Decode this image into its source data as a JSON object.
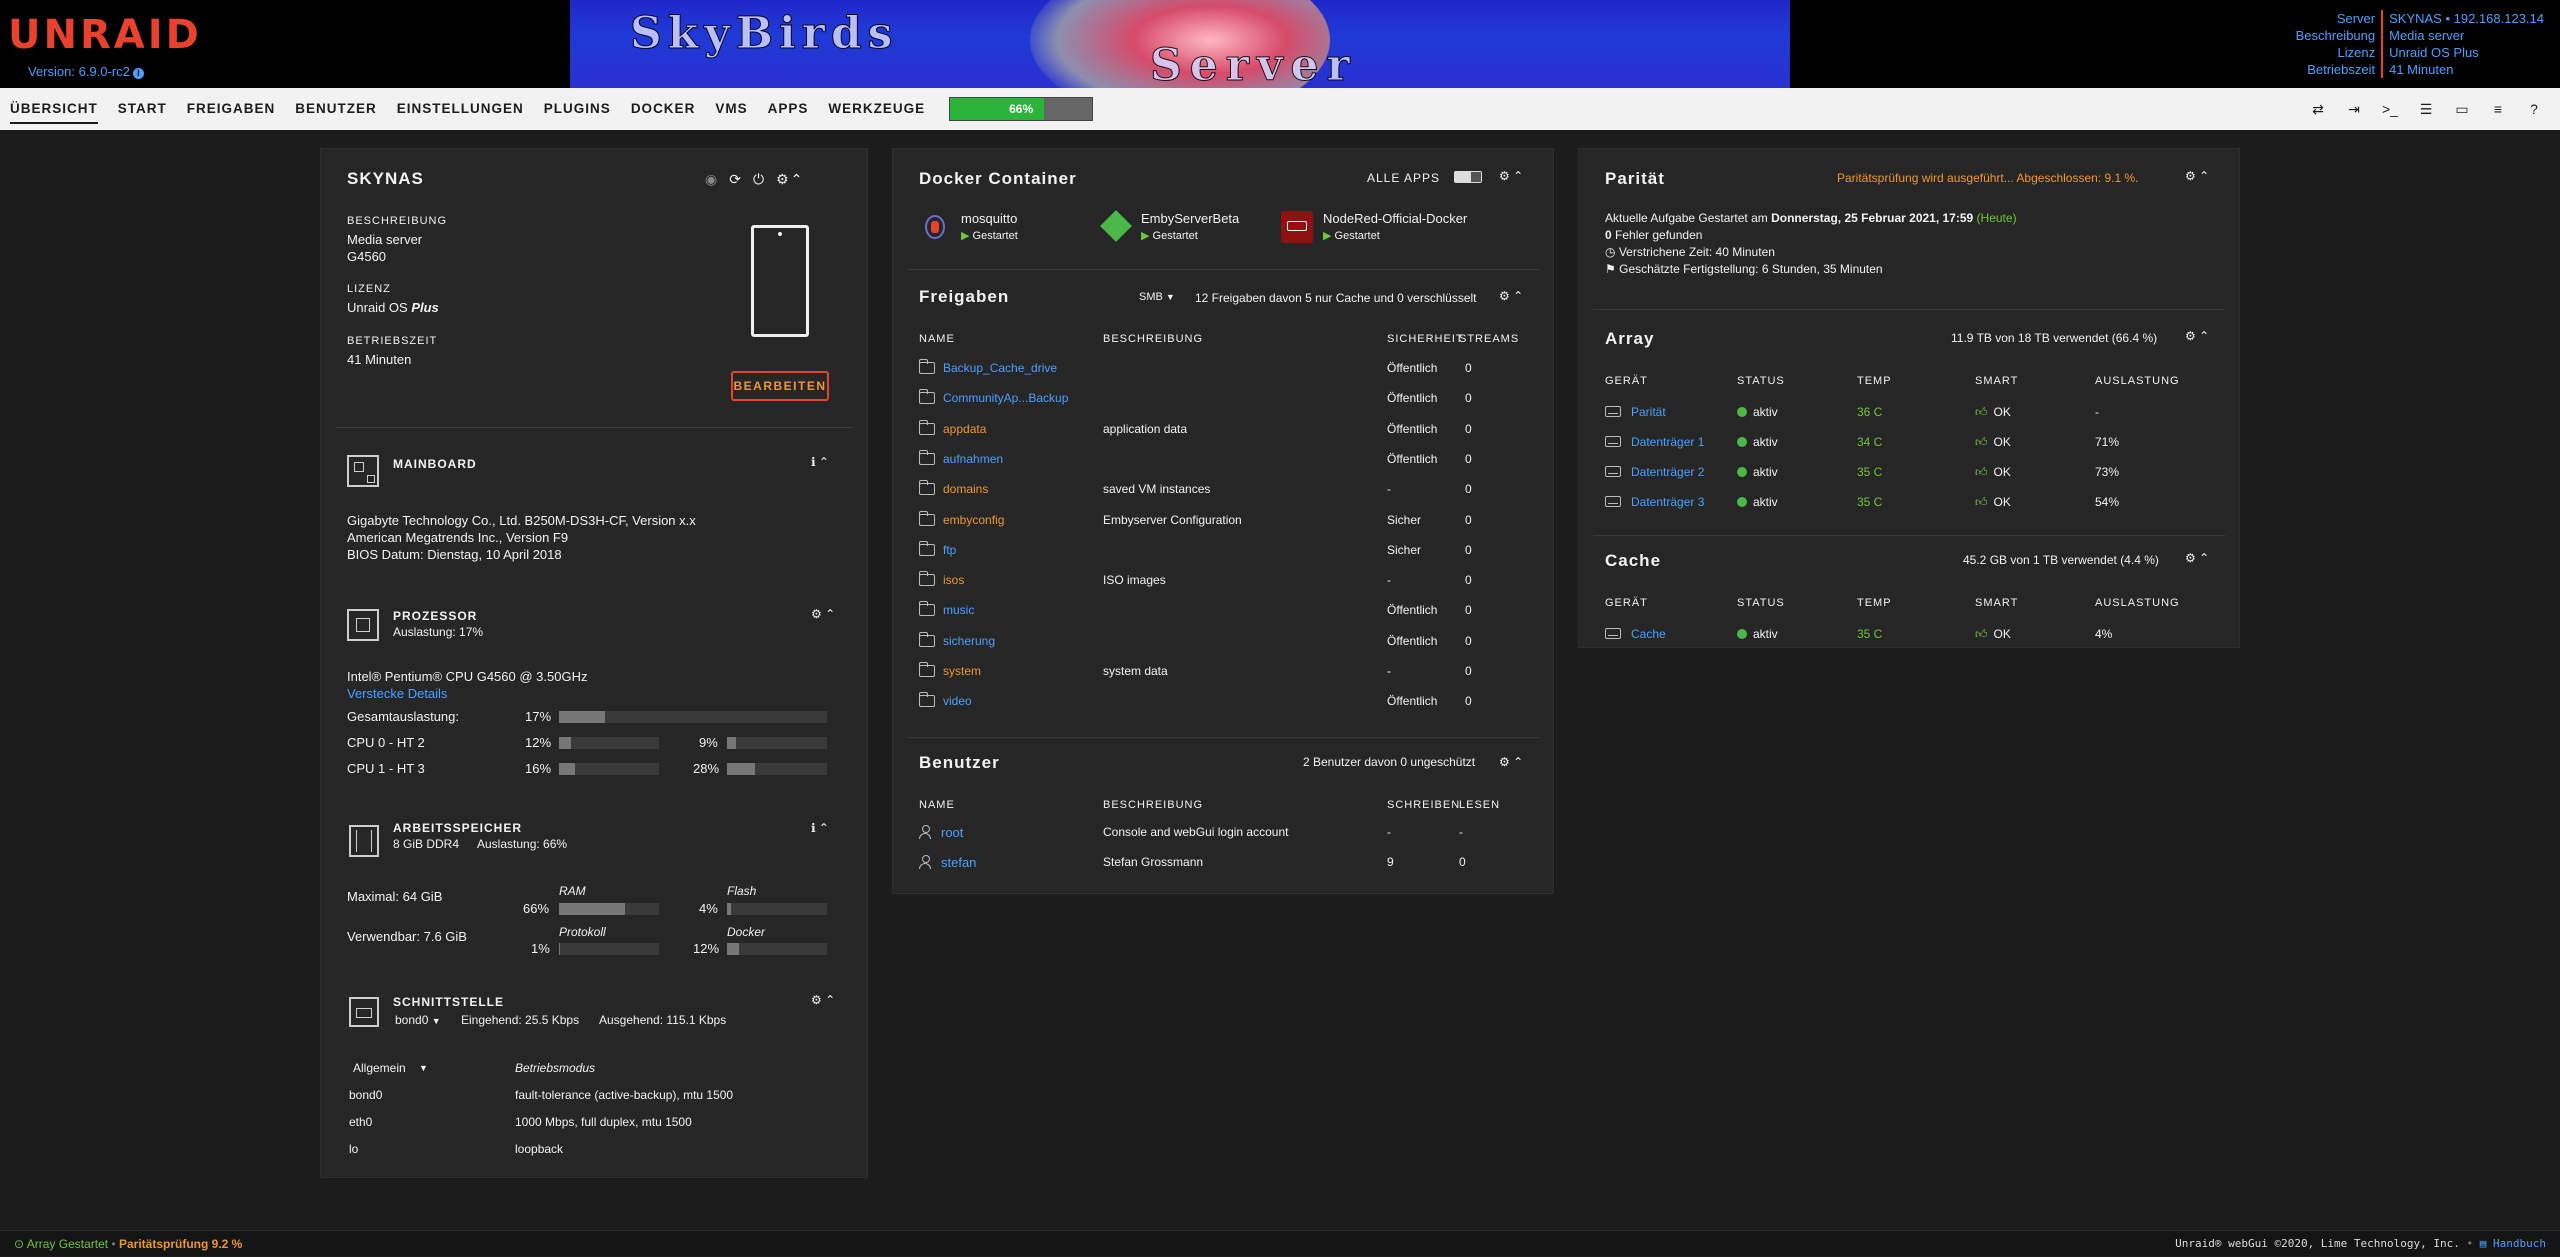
{
  "header": {
    "logo": "UNRAID",
    "version": "Version: 6.9.0-rc2",
    "banner_line1": "SkyBirds",
    "banner_line2": "Server",
    "info": [
      {
        "k": "Server",
        "v": "SKYNAS • 192.168.123.14"
      },
      {
        "k": "Beschreibung",
        "v": "Media server"
      },
      {
        "k": "Lizenz",
        "v": "Unraid OS Plus"
      },
      {
        "k": "Betriebszeit",
        "v": "41 Minuten"
      }
    ]
  },
  "nav": {
    "items": [
      "ÜBERSICHT",
      "START",
      "FREIGABEN",
      "BENUTZER",
      "EINSTELLUNGEN",
      "PLUGINS",
      "DOCKER",
      "VMS",
      "APPS",
      "WERKZEUGE"
    ],
    "progress_label": "66%",
    "progress_value": 0.66
  },
  "server": {
    "name": "SKYNAS",
    "desc_label": "BESCHREIBUNG",
    "desc1": "Media server",
    "desc2": "G4560",
    "license_label": "LIZENZ",
    "license_prefix": "Unraid OS ",
    "license_tier": "Plus",
    "uptime_label": "BETRIEBSZEIT",
    "uptime": "41 Minuten",
    "edit_button": "BEARBEITEN"
  },
  "mainboard": {
    "title": "MAINBOARD",
    "line1": "Gigabyte Technology Co., Ltd. B250M-DS3H-CF, Version x.x",
    "line2": "American Megatrends Inc., Version F9",
    "line3": "BIOS Datum: Dienstag, 10 April 2018"
  },
  "processor": {
    "title": "PROZESSOR",
    "load": "Auslastung: 17%",
    "model": "Intel® Pentium® CPU G4560 @ 3.50GHz",
    "hide_details": "Verstecke Details",
    "total_label": "Gesamtauslastung:",
    "total_pct": "17%",
    "total_val": 0.17,
    "cores": [
      {
        "label": "CPU 0 - HT 2",
        "a": "12%",
        "av": 0.12,
        "b": "9%",
        "bv": 0.09
      },
      {
        "label": "CPU 1 - HT 3",
        "a": "16%",
        "av": 0.16,
        "b": "28%",
        "bv": 0.28
      }
    ]
  },
  "memory": {
    "title": "ARBEITSSPEICHER",
    "sub1": "8 GiB DDR4",
    "sub2": "Auslastung: 66%",
    "max": "Maximal: 64 GiB",
    "usable": "Verwendbar: 7.6 GiB",
    "ram_label": "RAM",
    "ram_pct": "66%",
    "ram_val": 0.66,
    "flash_label": "Flash",
    "flash_pct": "4%",
    "flash_val": 0.04,
    "log_label": "Protokoll",
    "log_pct": "1%",
    "log_val": 0.01,
    "docker_label": "Docker",
    "docker_pct": "12%",
    "docker_val": 0.12
  },
  "interface": {
    "title": "SCHNITTSTELLE",
    "iface": "bond0",
    "in": "Eingehend: 25.5 Kbps",
    "out": "Ausgehend: 115.1 Kbps",
    "select": "Allgemein",
    "mode_header": "Betriebsmodus",
    "rows": [
      {
        "name": "bond0",
        "value": "fault-tolerance (active-backup), mtu 1500"
      },
      {
        "name": "eth0",
        "value": "1000 Mbps, full duplex, mtu 1500"
      },
      {
        "name": "lo",
        "value": "loopback"
      }
    ]
  },
  "docker": {
    "title": "Docker Container",
    "all_apps": "ALLE APPS",
    "containers": [
      {
        "name": "mosquitto",
        "status": "Gestartet"
      },
      {
        "name": "EmbyServerBeta",
        "status": "Gestartet"
      },
      {
        "name": "NodeRed-Official-Docker",
        "status": "Gestartet"
      }
    ]
  },
  "shares": {
    "title": "Freigaben",
    "proto": "SMB",
    "summary": "12 Freigaben davon 5 nur Cache und 0 verschlüsselt",
    "headers": [
      "NAME",
      "BESCHREIBUNG",
      "SICHERHEIT",
      "STREAMS"
    ],
    "rows": [
      {
        "name": "Backup_Cache_drive",
        "desc": "",
        "sec": "Öffentlich",
        "streams": "0",
        "color": "blue"
      },
      {
        "name": "CommunityAp...Backup",
        "desc": "",
        "sec": "Öffentlich",
        "streams": "0",
        "color": "blue"
      },
      {
        "name": "appdata",
        "desc": "application data",
        "sec": "Öffentlich",
        "streams": "0",
        "color": "orange"
      },
      {
        "name": "aufnahmen",
        "desc": "",
        "sec": "Öffentlich",
        "streams": "0",
        "color": "blue"
      },
      {
        "name": "domains",
        "desc": "saved VM instances",
        "sec": "-",
        "streams": "0",
        "color": "orange"
      },
      {
        "name": "embyconfig",
        "desc": "Embyserver Configuration",
        "sec": "Sicher",
        "streams": "0",
        "color": "orange"
      },
      {
        "name": "ftp",
        "desc": "",
        "sec": "Sicher",
        "streams": "0",
        "color": "blue"
      },
      {
        "name": "isos",
        "desc": "ISO images",
        "sec": "-",
        "streams": "0",
        "color": "orange"
      },
      {
        "name": "music",
        "desc": "",
        "sec": "Öffentlich",
        "streams": "0",
        "color": "blue"
      },
      {
        "name": "sicherung",
        "desc": "",
        "sec": "Öffentlich",
        "streams": "0",
        "color": "blue"
      },
      {
        "name": "system",
        "desc": "system data",
        "sec": "-",
        "streams": "0",
        "color": "orange"
      },
      {
        "name": "video",
        "desc": "",
        "sec": "Öffentlich",
        "streams": "0",
        "color": "blue"
      }
    ]
  },
  "users": {
    "title": "Benutzer",
    "summary": "2 Benutzer davon 0 ungeschützt",
    "headers": [
      "NAME",
      "BESCHREIBUNG",
      "SCHREIBEN",
      "LESEN"
    ],
    "rows": [
      {
        "name": "root",
        "desc": "Console and webGui login account",
        "write": "-",
        "read": "-"
      },
      {
        "name": "stefan",
        "desc": "Stefan Grossmann",
        "write": "9",
        "read": "0"
      }
    ]
  },
  "parity": {
    "title": "Parität",
    "status": "Paritätsprüfung wird ausgeführt... Abgeschlossen: 9.1 %.",
    "task_prefix": "Aktuelle Aufgabe Gestartet am ",
    "task_date": "Donnerstag, 25 Februar 2021, 17:59",
    "task_today": "(Heute)",
    "errors_count": "0",
    "errors_text": " Fehler gefunden",
    "elapsed": "Verstrichene Zeit: 40 Minuten",
    "eta": "Geschätzte Fertigstellung: 6 Stunden, 35 Minuten"
  },
  "array": {
    "title": "Array",
    "summary": "11.9 TB von 18 TB verwendet (66.4 %)",
    "headers": [
      "GERÄT",
      "STATUS",
      "TEMP",
      "SMART",
      "AUSLASTUNG"
    ],
    "rows": [
      {
        "dev": "Parität",
        "status": "aktiv",
        "temp": "36 C",
        "smart": "OK",
        "usage": "-"
      },
      {
        "dev": "Datenträger 1",
        "status": "aktiv",
        "temp": "34 C",
        "smart": "OK",
        "usage": "71%"
      },
      {
        "dev": "Datenträger 2",
        "status": "aktiv",
        "temp": "35 C",
        "smart": "OK",
        "usage": "73%"
      },
      {
        "dev": "Datenträger 3",
        "status": "aktiv",
        "temp": "35 C",
        "smart": "OK",
        "usage": "54%"
      }
    ]
  },
  "cache": {
    "title": "Cache",
    "summary": "45.2 GB von 1 TB verwendet (4.4 %)",
    "headers": [
      "GERÄT",
      "STATUS",
      "TEMP",
      "SMART",
      "AUSLASTUNG"
    ],
    "rows": [
      {
        "dev": "Cache",
        "status": "aktiv",
        "temp": "35 C",
        "smart": "OK",
        "usage": "4%"
      }
    ]
  },
  "footer": {
    "array_status": "Array Gestartet",
    "parity_status": "Paritätsprüfung 9.2 %",
    "copyright": "Unraid® webGui ©2020, Lime Technology, Inc.",
    "manual": "Handbuch"
  },
  "colors": {
    "accent": "#e8422f",
    "link": "#4aa0ff",
    "warning": "#f0962f",
    "ok": "#4cb848",
    "progress": "#2ab43a"
  }
}
